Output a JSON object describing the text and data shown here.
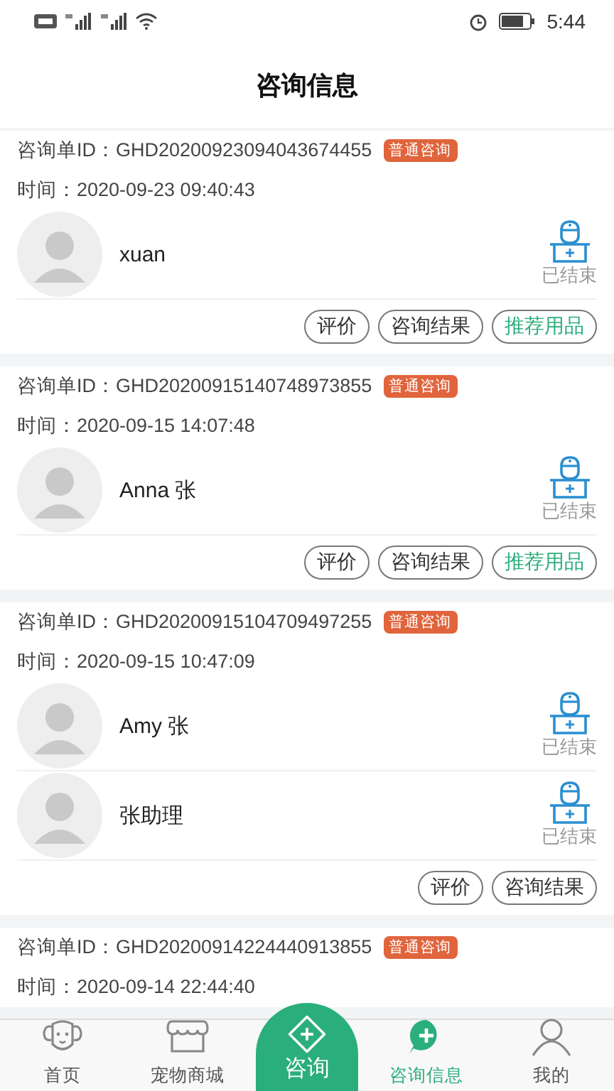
{
  "status_bar": {
    "time": "5:44"
  },
  "header": {
    "title": "咨询信息"
  },
  "orders": [
    {
      "id_label": "咨询单ID：",
      "id": "GHD20200923094043674455",
      "tag": "普通咨询",
      "time_label": "时间：",
      "time": "2020-09-23 09:40:43",
      "consultants": [
        {
          "name": "xuan",
          "status": "已结束"
        }
      ],
      "actions": [
        {
          "label": "评价",
          "kind": "normal"
        },
        {
          "label": "咨询结果",
          "kind": "normal"
        },
        {
          "label": "推荐用品",
          "kind": "primary"
        }
      ]
    },
    {
      "id_label": "咨询单ID：",
      "id": "GHD20200915140748973855",
      "tag": "普通咨询",
      "time_label": "时间：",
      "time": "2020-09-15 14:07:48",
      "consultants": [
        {
          "name": "Anna 张",
          "status": "已结束"
        }
      ],
      "actions": [
        {
          "label": "评价",
          "kind": "normal"
        },
        {
          "label": "咨询结果",
          "kind": "normal"
        },
        {
          "label": "推荐用品",
          "kind": "primary"
        }
      ]
    },
    {
      "id_label": "咨询单ID：",
      "id": "GHD20200915104709497255",
      "tag": "普通咨询",
      "time_label": "时间：",
      "time": "2020-09-15 10:47:09",
      "consultants": [
        {
          "name": "Amy 张",
          "status": "已结束"
        },
        {
          "name": "张助理",
          "status": "已结束"
        }
      ],
      "actions": [
        {
          "label": "评价",
          "kind": "normal"
        },
        {
          "label": "咨询结果",
          "kind": "normal"
        }
      ]
    },
    {
      "id_label": "咨询单ID：",
      "id": "GHD20200914224440913855",
      "tag": "普通咨询",
      "time_label": "时间：",
      "time": "2020-09-14 22:44:40"
    }
  ],
  "tab_bar": [
    {
      "label": "首页",
      "kind": "home",
      "selected": false
    },
    {
      "label": "宠物商城",
      "kind": "shop",
      "selected": false
    },
    {
      "label": "咨询",
      "kind": "center",
      "selected": false
    },
    {
      "label": "咨询信息",
      "kind": "messages",
      "selected": true
    },
    {
      "label": "我的",
      "kind": "me",
      "selected": false
    }
  ]
}
